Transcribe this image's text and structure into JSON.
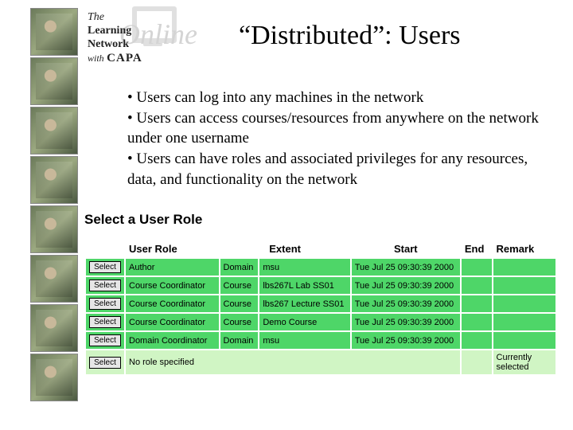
{
  "logo": {
    "the": "The",
    "learning": "Learning",
    "network": "Network",
    "with": "with",
    "capa": "CAPA",
    "online": "Online"
  },
  "title": "“Distributed”: Users",
  "bullets": [
    "Users can log into any machines in the network",
    "Users can access courses/resources from anywhere on the network under one username",
    "Users can have roles and associated privileges for any resources, data, and functionality on the network"
  ],
  "section_label": "Select a User Role",
  "table": {
    "headers": {
      "role": "User Role",
      "extent": "Extent",
      "start": "Start",
      "end": "End",
      "remark": "Remark"
    },
    "select_label": "Select",
    "rows": [
      {
        "role": "Author",
        "extent_type": "Domain",
        "extent_val": "msu",
        "start": "Tue Jul 25 09:30:39 2000",
        "end": "",
        "remark": ""
      },
      {
        "role": "Course Coordinator",
        "extent_type": "Course",
        "extent_val": "lbs267L Lab SS01",
        "start": "Tue Jul 25 09:30:39 2000",
        "end": "",
        "remark": ""
      },
      {
        "role": "Course Coordinator",
        "extent_type": "Course",
        "extent_val": "lbs267 Lecture SS01",
        "start": "Tue Jul 25 09:30:39 2000",
        "end": "",
        "remark": ""
      },
      {
        "role": "Course Coordinator",
        "extent_type": "Course",
        "extent_val": "Demo Course",
        "start": "Tue Jul 25 09:30:39 2000",
        "end": "",
        "remark": ""
      },
      {
        "role": "Domain Coordinator",
        "extent_type": "Domain",
        "extent_val": "msu",
        "start": "Tue Jul 25 09:30:39 2000",
        "end": "",
        "remark": ""
      }
    ],
    "selected_row": {
      "role": "No role specified",
      "remark": "Currently selected"
    }
  }
}
